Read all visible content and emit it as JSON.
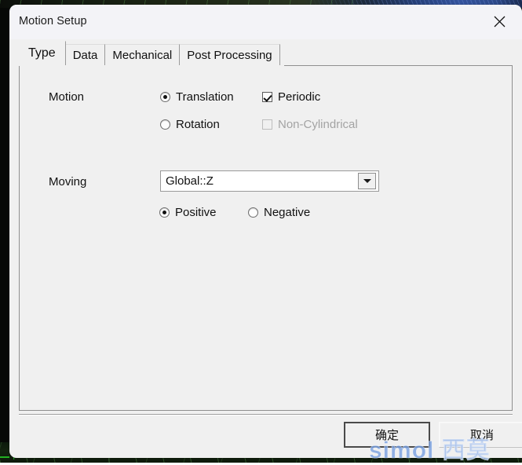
{
  "window": {
    "title": "Motion Setup",
    "close_icon": "close-icon"
  },
  "tabs": [
    {
      "label": "Type",
      "active": true
    },
    {
      "label": "Data",
      "active": false
    },
    {
      "label": "Mechanical",
      "active": false
    },
    {
      "label": "Post Processing",
      "active": false
    }
  ],
  "form": {
    "motion": {
      "label": "Motion",
      "type_options": [
        {
          "label": "Translation",
          "selected": true
        },
        {
          "label": "Rotation",
          "selected": false
        }
      ],
      "flags": [
        {
          "label": "Periodic",
          "checked": true,
          "disabled": false
        },
        {
          "label": "Non-Cylindrical",
          "checked": false,
          "disabled": true
        }
      ]
    },
    "moving": {
      "label": "Moving",
      "axis_value": "Global::Z",
      "axis_dropdown_icon": "chevron-down-icon",
      "direction_options": [
        {
          "label": "Positive",
          "selected": true
        },
        {
          "label": "Negative",
          "selected": false
        }
      ]
    }
  },
  "footer": {
    "ok_label": "确定",
    "cancel_label": "取消"
  },
  "watermark": {
    "text": "simol 西莫",
    "color": "#78a0e1"
  }
}
